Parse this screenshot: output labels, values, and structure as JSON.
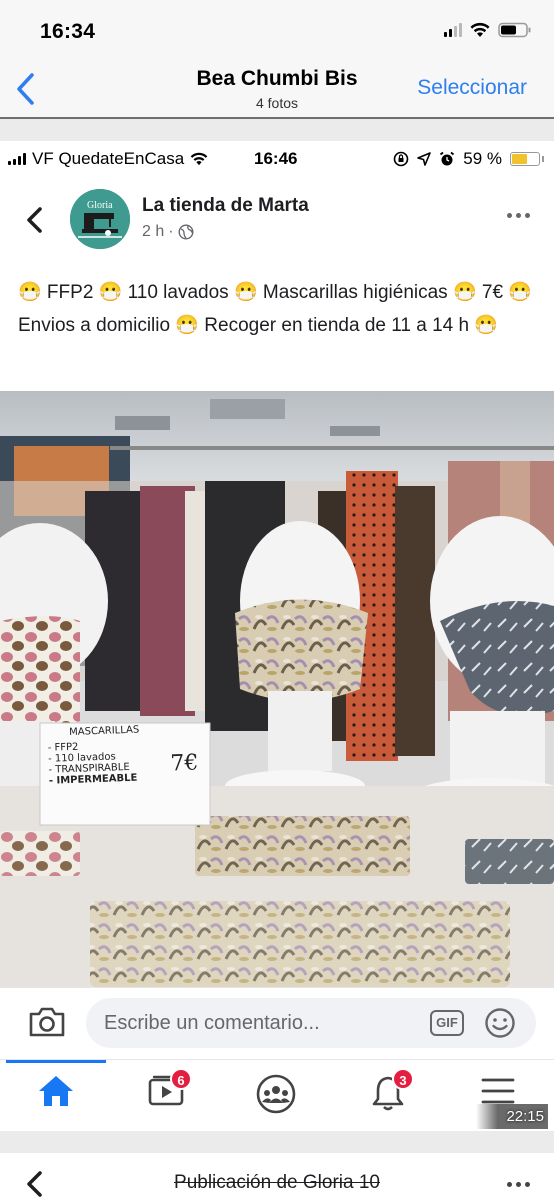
{
  "ios_status": {
    "time": "16:34"
  },
  "photos_nav": {
    "title": "Bea Chumbi Bis",
    "subtitle": "4 fotos",
    "select_label": "Seleccionar"
  },
  "inner_status": {
    "carrier": "VF QuedateEnCasa",
    "time": "16:46",
    "battery": "59 %",
    "battery_level": 0.59
  },
  "post": {
    "page_name": "La tienda de Marta",
    "avatar_text": "Gloria",
    "time_ago": "2 h",
    "separator": "·",
    "text": "😷 FFP2 😷 110 lavados 😷 Mascarillas higiénicas 😷 7€ 😷 Envios a domicilio 😷 Recoger en tienda de 11 a 14 h 😷"
  },
  "photo_sign": {
    "title": "MASCARILLAS",
    "items": [
      "- FFP2",
      "- 110 lavados",
      "- TRANSPIRABLE",
      "- IMPERMEABLE"
    ],
    "price": "7€"
  },
  "comment_bar": {
    "placeholder": "Escribe un comentario...",
    "gif_label": "GIF"
  },
  "tabbar": {
    "video_badge": "6",
    "notifications_badge": "3",
    "video_time": "22:15"
  },
  "bottom_bar": {
    "title": "Publicación de Gloria 10"
  },
  "colors": {
    "fb_blue": "#1877f2",
    "ios_blue": "#2f7ef0",
    "badge_red": "#e41e3f",
    "avatar_teal": "#3f9a8f"
  }
}
